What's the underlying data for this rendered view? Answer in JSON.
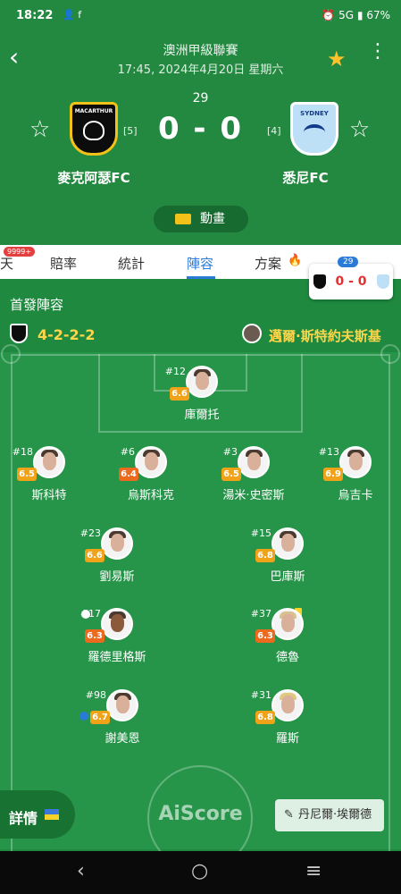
{
  "status": {
    "time": "18:22",
    "icons_left": "👤 f",
    "right": "⏰ 5G ▮ 67%"
  },
  "header": {
    "league": "澳洲甲級聯賽",
    "datetime": "17:45, 2024年4月20日 星期六",
    "minute": "29",
    "score": "0 - 0",
    "home": {
      "name": "麥克阿瑟FC",
      "rank": "[5]",
      "crest_text": "MACARTHUR"
    },
    "away": {
      "name": "悉尼FC",
      "rank": "[4]",
      "crest_text": "SYDNEY"
    },
    "animation_label": "動畫"
  },
  "tabs": {
    "items": [
      "天",
      "賠率",
      "統計",
      "陣容",
      "方案"
    ],
    "active": "陣容",
    "chat_badge": "9999+"
  },
  "mini_score": {
    "minute": "29",
    "score": "0 - 0"
  },
  "lineup": {
    "title": "首發陣容",
    "formation": "4-2-2-2",
    "coach": "邁爾·斯特約夫斯基",
    "players": [
      {
        "num": "#12",
        "rating": "6.6",
        "name": "庫爾托"
      },
      {
        "num": "#18",
        "rating": "6.5",
        "name": "斯科特"
      },
      {
        "num": "#6",
        "rating": "6.4",
        "name": "烏斯科克"
      },
      {
        "num": "#3",
        "rating": "6.5",
        "name": "湯米·史密斯"
      },
      {
        "num": "#13",
        "rating": "6.9",
        "name": "烏吉卡"
      },
      {
        "num": "#23",
        "rating": "6.6",
        "name": "劉易斯"
      },
      {
        "num": "#15",
        "rating": "6.8",
        "name": "巴庫斯"
      },
      {
        "num": "#17",
        "rating": "6.3",
        "name": "羅德里格斯"
      },
      {
        "num": "#37",
        "rating": "6.3",
        "name": "德魯"
      },
      {
        "num": "#98",
        "rating": "6.7",
        "name": "謝美恩"
      },
      {
        "num": "#31",
        "rating": "6.8",
        "name": "羅斯"
      }
    ]
  },
  "footer": {
    "details_label": "詳情",
    "watermark": "AiScore",
    "sub_player": "丹尼爾·埃爾德"
  },
  "colors": {
    "header_green": "#238840",
    "pitch_green": "#26954a",
    "rating": "#f0a218",
    "accent_tab": "#2a7ad8",
    "coach_text": "#ffd54a"
  }
}
